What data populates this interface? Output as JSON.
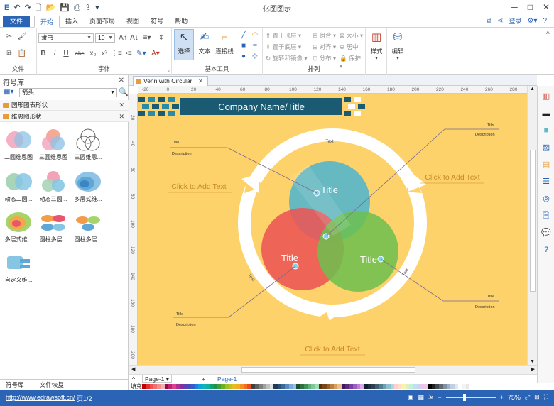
{
  "app": {
    "title": "亿图图示",
    "quick_access": [
      "save-icon",
      "undo-icon",
      "redo-icon",
      "new-icon",
      "open-icon",
      "print-icon",
      "export-icon"
    ],
    "window_controls": [
      "─",
      "□",
      "✕"
    ]
  },
  "menu": {
    "file": "文件",
    "tabs": [
      "开始",
      "插入",
      "页面布局",
      "视图",
      "符号",
      "帮助"
    ],
    "active_tab": "开始",
    "login": "登录"
  },
  "ribbon": {
    "groups": {
      "file": "文件",
      "font": "字体",
      "basic_tools": "基本工具",
      "arrange": "排列",
      "style": "样式",
      "edit": "编辑"
    },
    "font_name": "隶书",
    "font_size": "10",
    "format_buttons": [
      "B",
      "I",
      "U",
      "abc",
      "x₂",
      "x²"
    ],
    "tools": {
      "select": "选择",
      "text": "文本",
      "connector": "连接线"
    },
    "arrange": {
      "bring_front": "置于顶层",
      "send_back": "置于底层",
      "rotate_mirror": "旋转和镜像",
      "group": "组合",
      "align": "对齐",
      "distribute": "分布",
      "size": "大小",
      "center": "居中",
      "protect": "保护"
    },
    "style_btn": "样式",
    "edit_btn": "编辑"
  },
  "library": {
    "title": "符号库",
    "search_value": "箭头",
    "categories": [
      {
        "label": "圆形图表形状"
      },
      {
        "label": "维恩图形状"
      }
    ],
    "shapes": [
      {
        "label": "二圆维恩图"
      },
      {
        "label": "三圆维恩图"
      },
      {
        "label": "三圆维恩..."
      },
      {
        "label": "动态二圆..."
      },
      {
        "label": "动态三圆..."
      },
      {
        "label": "多层式维..."
      },
      {
        "label": "多层式维..."
      },
      {
        "label": "圆柱多层..."
      },
      {
        "label": "圆柱多层..."
      },
      {
        "label": "自定义维..."
      }
    ],
    "footer_tabs": [
      "符号库",
      "文件恢复"
    ]
  },
  "document": {
    "tab_label": "Venn with Circular",
    "page_tab": "Page-1",
    "page_link": "Page-1"
  },
  "diagram": {
    "company_title": "Company Name/Title",
    "circle_labels": [
      "Title",
      "Title",
      "Title"
    ],
    "click_texts": [
      "Click to Add Text",
      "Click to Add Text",
      "Click to Add Text"
    ],
    "callout_title": "Title",
    "callout_desc": "Description",
    "arc_text": "Text",
    "colors": {
      "background": "#fdd26b",
      "header_bar": "#1b5a73",
      "circle_top": "#59b5c9",
      "circle_left": "#ec5454",
      "circle_right": "#6cbf4f"
    }
  },
  "rulers": {
    "horizontal": [
      "-20",
      "0",
      "20",
      "40",
      "60",
      "80",
      "100",
      "120",
      "140",
      "160",
      "180",
      "200",
      "220",
      "240",
      "260",
      "280",
      "300"
    ],
    "vertical": [
      "20",
      "40",
      "60",
      "80",
      "100",
      "120",
      "140",
      "160",
      "180",
      "200"
    ]
  },
  "palette": {
    "label": "填充",
    "colors": [
      "#c00000",
      "#e03030",
      "#f05050",
      "#f07070",
      "#f09090",
      "#f0b0b0",
      "#8b0a50",
      "#c02070",
      "#e04090",
      "#b03090",
      "#8030a0",
      "#6040b0",
      "#4050c0",
      "#3060d0",
      "#2080e0",
      "#10a0e0",
      "#10b0c0",
      "#10b0a0",
      "#10a070",
      "#209050",
      "#40a030",
      "#70b020",
      "#a0c020",
      "#c0c020",
      "#e0c020",
      "#f0b020",
      "#f09020",
      "#f07020",
      "#e05020",
      "#404040",
      "#606060",
      "#808080",
      "#a0a0a0",
      "#c0c0c0",
      "#e0e0e0",
      "#1f3a5a",
      "#2a5078",
      "#3a6a9a",
      "#5a8abc",
      "#7aaad8",
      "#9ac0e0",
      "#205030",
      "#307040",
      "#409058",
      "#60b078",
      "#80c898",
      "#a0dcb8",
      "#5a3010",
      "#7a4818",
      "#9a6028",
      "#ba8040",
      "#d8a060",
      "#e8c090",
      "#3a1a5a",
      "#5a2a80",
      "#7a40a0",
      "#9a60c0",
      "#ba80d8",
      "#d8a8e8",
      "#102030",
      "#203040",
      "#304050",
      "#406070",
      "#508090",
      "#70a0b0",
      "#90c0d0",
      "#b0d8e0",
      "#ffd0d0",
      "#ffe0c0",
      "#fff0b0",
      "#e0f0c0",
      "#c0f0e0",
      "#c0e0f0",
      "#d0d0f0",
      "#e0c8f0",
      "#f0c8e0",
      "#000000",
      "#202020",
      "#404850",
      "#606870",
      "#8090a0",
      "#a0b0c0",
      "#c0d0e0",
      "#e0e8f0",
      "#ffffff",
      "#f4f4f4",
      "#e8e8e8"
    ]
  },
  "status": {
    "url": "http://www.edrawsoft.cn/",
    "pages": "页1/2",
    "zoom": "75%"
  }
}
